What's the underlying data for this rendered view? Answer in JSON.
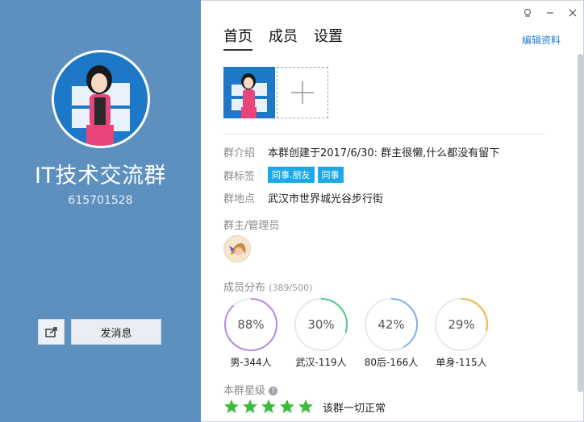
{
  "profile": {
    "group_name": "IT技术交流群",
    "group_id": "615701528",
    "send_message_label": "发消息"
  },
  "window": {
    "controls": [
      "pin-icon",
      "minimize-icon",
      "close-icon"
    ]
  },
  "tabs": [
    {
      "label": "首页",
      "active": true
    },
    {
      "label": "成员",
      "active": false
    },
    {
      "label": "设置",
      "active": false
    }
  ],
  "edit_link": "编辑资料",
  "info": {
    "intro_label": "群介绍",
    "intro_value": "本群创建于2017/6/30:  群主很懒,什么都没有留下",
    "tags_label": "群标签",
    "tags": [
      "同事.朋友",
      "同事"
    ],
    "location_label": "群地点",
    "location_value": "武汉市世界城光谷步行街"
  },
  "admins": {
    "title": "群主/管理员"
  },
  "distribution": {
    "title": "成员分布",
    "count": "(389/500)",
    "stats": [
      {
        "percent": "88%",
        "value": 88,
        "label": "男-344人",
        "color": "#b48ce6"
      },
      {
        "percent": "30%",
        "value": 30,
        "label": "武汉-119人",
        "color": "#4cc98a"
      },
      {
        "percent": "42%",
        "value": 42,
        "label": "80后-166人",
        "color": "#7fb0e8"
      },
      {
        "percent": "29%",
        "value": 29,
        "label": "单身-115人",
        "color": "#f5b24a"
      }
    ]
  },
  "level": {
    "title": "本群星级",
    "stars": 5,
    "status": "该群一切正常",
    "star_color": "#3dbb3d"
  },
  "colors": {
    "left_panel": "#5d90bf",
    "accent": "#1a7bd6",
    "tag": "#1aa8e6"
  }
}
